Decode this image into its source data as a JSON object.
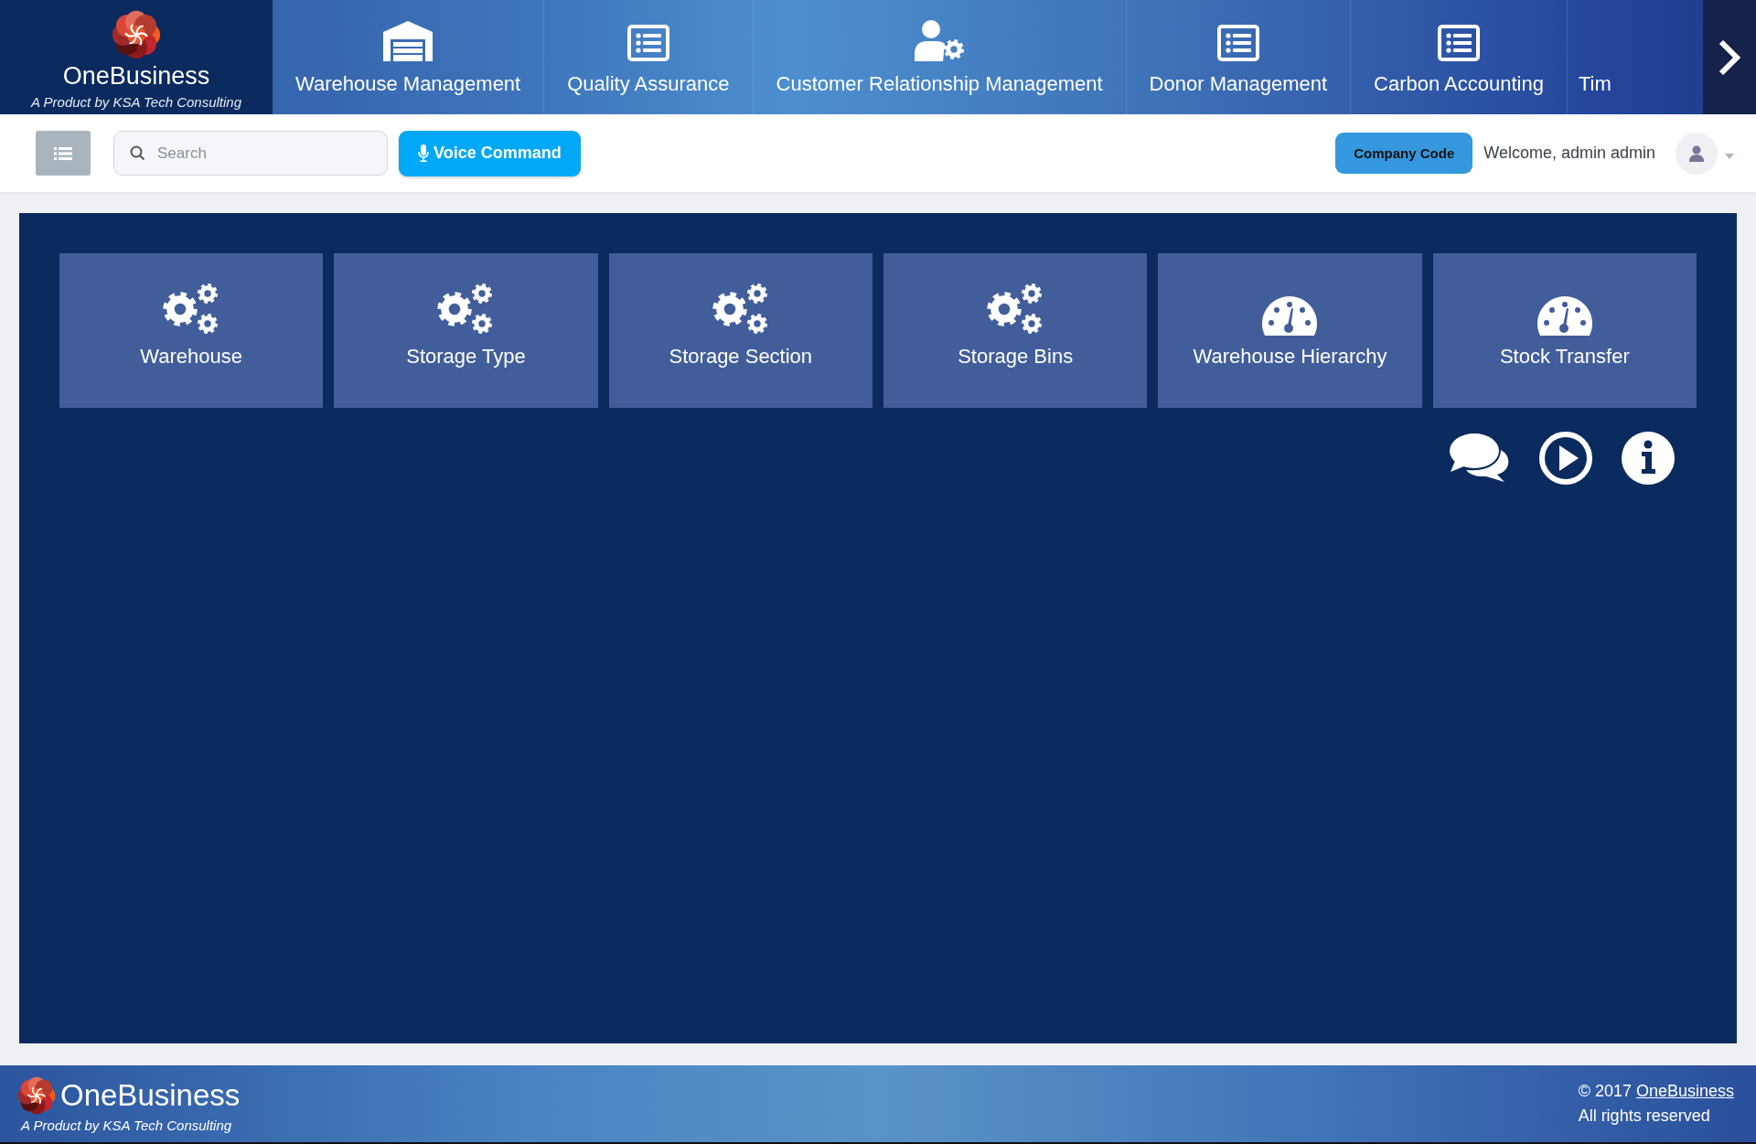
{
  "brand": {
    "name": "OneBusiness",
    "tagline": "A Product by KSA Tech Consulting"
  },
  "modules": [
    {
      "label": "Warehouse Management",
      "kind": "warehouse"
    },
    {
      "label": "Quality Assurance",
      "kind": "list"
    },
    {
      "label": "Customer Relationship Management",
      "kind": "user-gear"
    },
    {
      "label": "Donor Management",
      "kind": "list"
    },
    {
      "label": "Carbon Accounting",
      "kind": "list"
    },
    {
      "label": "Tim",
      "kind": "none"
    }
  ],
  "toolbar": {
    "search": {
      "placeholder": "Search"
    },
    "voice_button": "Voice Command",
    "company_button": "Company Code",
    "welcome": "Welcome, admin admin"
  },
  "tiles": [
    {
      "label": "Warehouse",
      "kind": "gears"
    },
    {
      "label": "Storage Type",
      "kind": "gears"
    },
    {
      "label": "Storage Section",
      "kind": "gears"
    },
    {
      "label": "Storage Bins",
      "kind": "gears"
    },
    {
      "label": "Warehouse Hierarchy",
      "kind": "gauge"
    },
    {
      "label": "Stock Transfer",
      "kind": "gauge"
    }
  ],
  "footer": {
    "brand": "OneBusiness",
    "tagline": "A Product by KSA Tech Consulting",
    "copyright": "© 2017",
    "copyright_link": "OneBusiness",
    "rights": "All rights reserved"
  }
}
